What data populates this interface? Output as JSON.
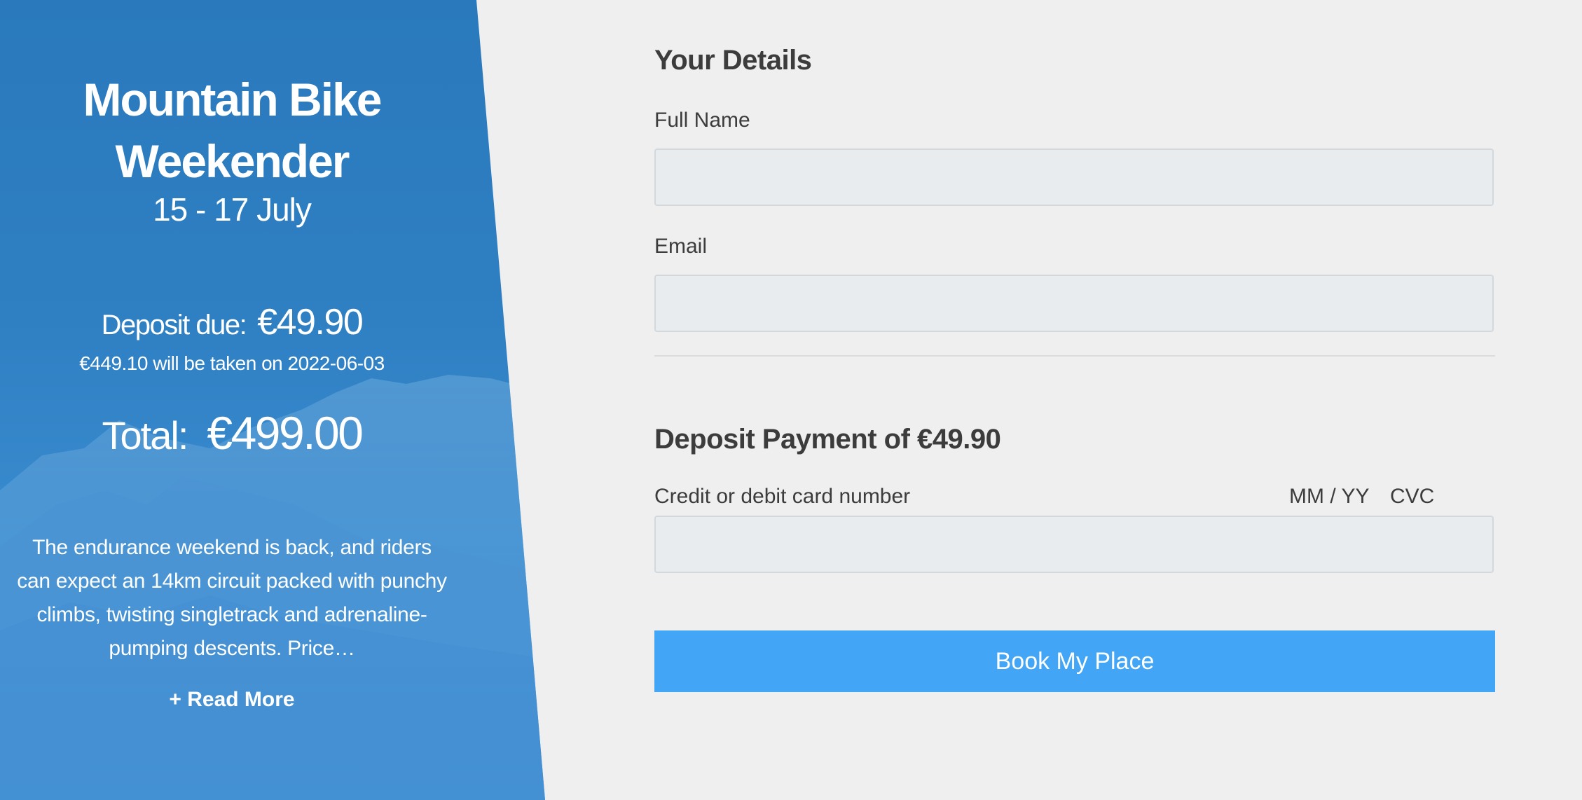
{
  "hero": {
    "title": "Mountain Bike Weekender",
    "dates": "15 - 17 July",
    "deposit_label": "Deposit due:",
    "deposit_value": "€49.90",
    "remaining_note": "€449.10 will be taken on 2022-06-03",
    "total_label": "Total:",
    "total_value": "€499.00",
    "description": "The endurance weekend is back, and riders can expect an 14km circuit packed with punchy climbs, twisting singletrack and adrenaline-pumping descents. Price…",
    "read_more": "+ Read More"
  },
  "form": {
    "details_title": "Your Details",
    "full_name_label": "Full Name",
    "full_name_value": "",
    "email_label": "Email",
    "email_value": "",
    "payment_title": "Deposit Payment of €49.90",
    "card_number_label": "Credit or debit card number",
    "expiry_label": "MM / YY",
    "cvc_label": "CVC",
    "card_value": "",
    "submit_label": "Book My Place"
  },
  "colors": {
    "hero_blue": "#2a79bd",
    "button_blue": "#42a5f5",
    "background": "#efefef",
    "input_background": "#e9ecef",
    "heading_text": "#3c3c3c"
  }
}
